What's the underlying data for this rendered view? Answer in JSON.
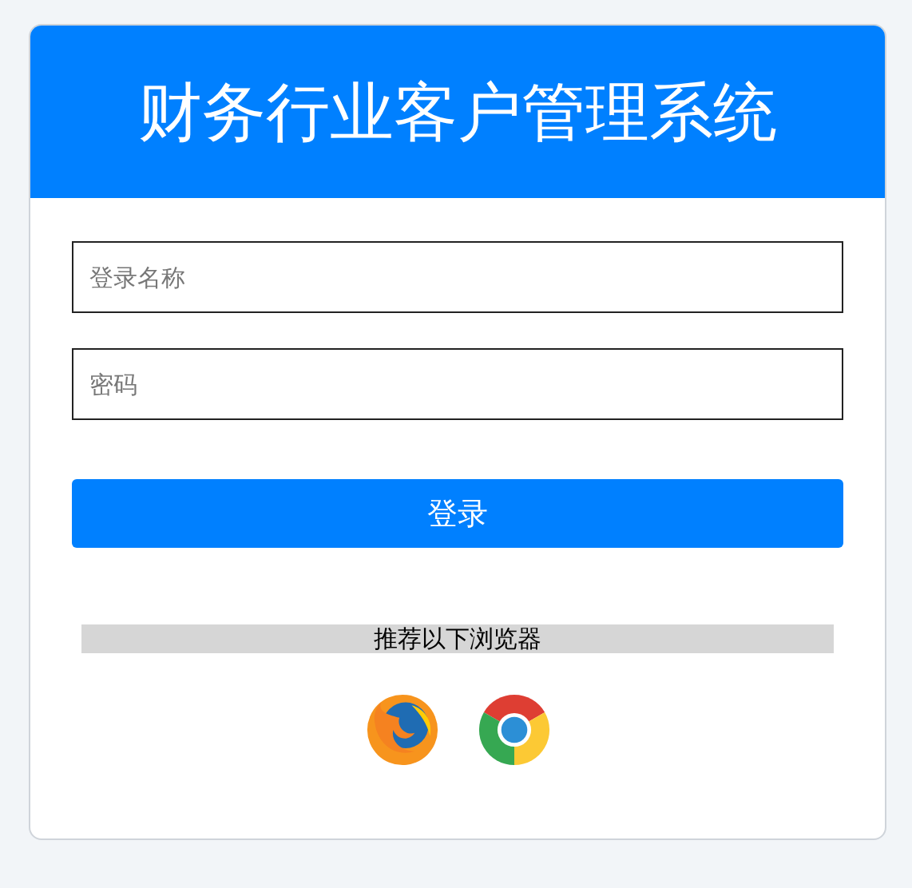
{
  "title": "财务行业客户管理系统",
  "fields": [
    {
      "placeholder": "登录名称"
    },
    {
      "placeholder": "密码"
    }
  ],
  "login_button": "登录",
  "browser_note": "推荐以下浏览器"
}
